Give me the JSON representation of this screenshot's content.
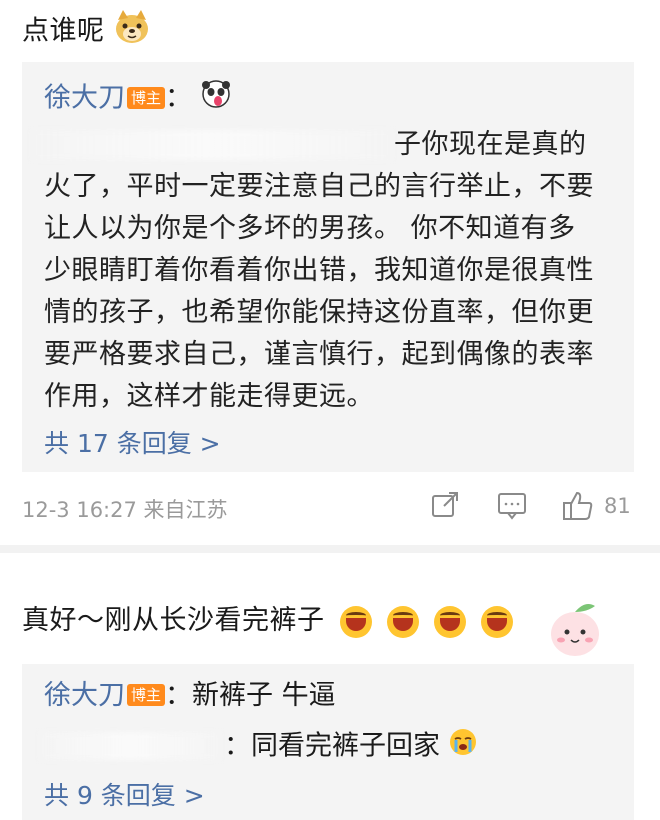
{
  "comment1": {
    "text": "点谁呢",
    "emoji_icon": "doge-icon",
    "reply": {
      "author": "徐大刀",
      "badge": "博主",
      "colon": "：",
      "emoji_icon": "panda-tongue-icon",
      "text_lines": [
        "子你现在是真的",
        "火了，平时一定要注意自己的言行举止，不要",
        "让人以为你是个多坏的男孩。 你不知道有多",
        "少眼睛盯着你看着你出错，我知道你是很真性",
        "情的孩子，也希望你能保持这份直率，但你更",
        "要严格要求自己，谨言慎行，起到偶像的表率",
        "作用，这样才能走得更远。"
      ],
      "more_replies": "共 17 条回复 >"
    },
    "footer": {
      "time": "12-3 16:27 来自江苏",
      "share_icon": "share-icon",
      "comment_icon": "comment-icon",
      "like_icon": "thumbs-up-icon",
      "like_count": "81"
    }
  },
  "comment2": {
    "text": "真好～刚从长沙看完裤子",
    "emoji_icons": [
      "laughing-icon",
      "laughing-icon",
      "laughing-icon",
      "laughing-icon"
    ],
    "decor_icon": "peach-sticker-icon",
    "replies": [
      {
        "author": "徐大刀",
        "badge": "博主",
        "text": "：新裤子 牛逼"
      },
      {
        "author": "",
        "badge": "",
        "text": "：同看完裤子回家"
      }
    ],
    "reply2_emoji": "crying-face-icon",
    "more_replies": "共 9 条回复 >"
  }
}
